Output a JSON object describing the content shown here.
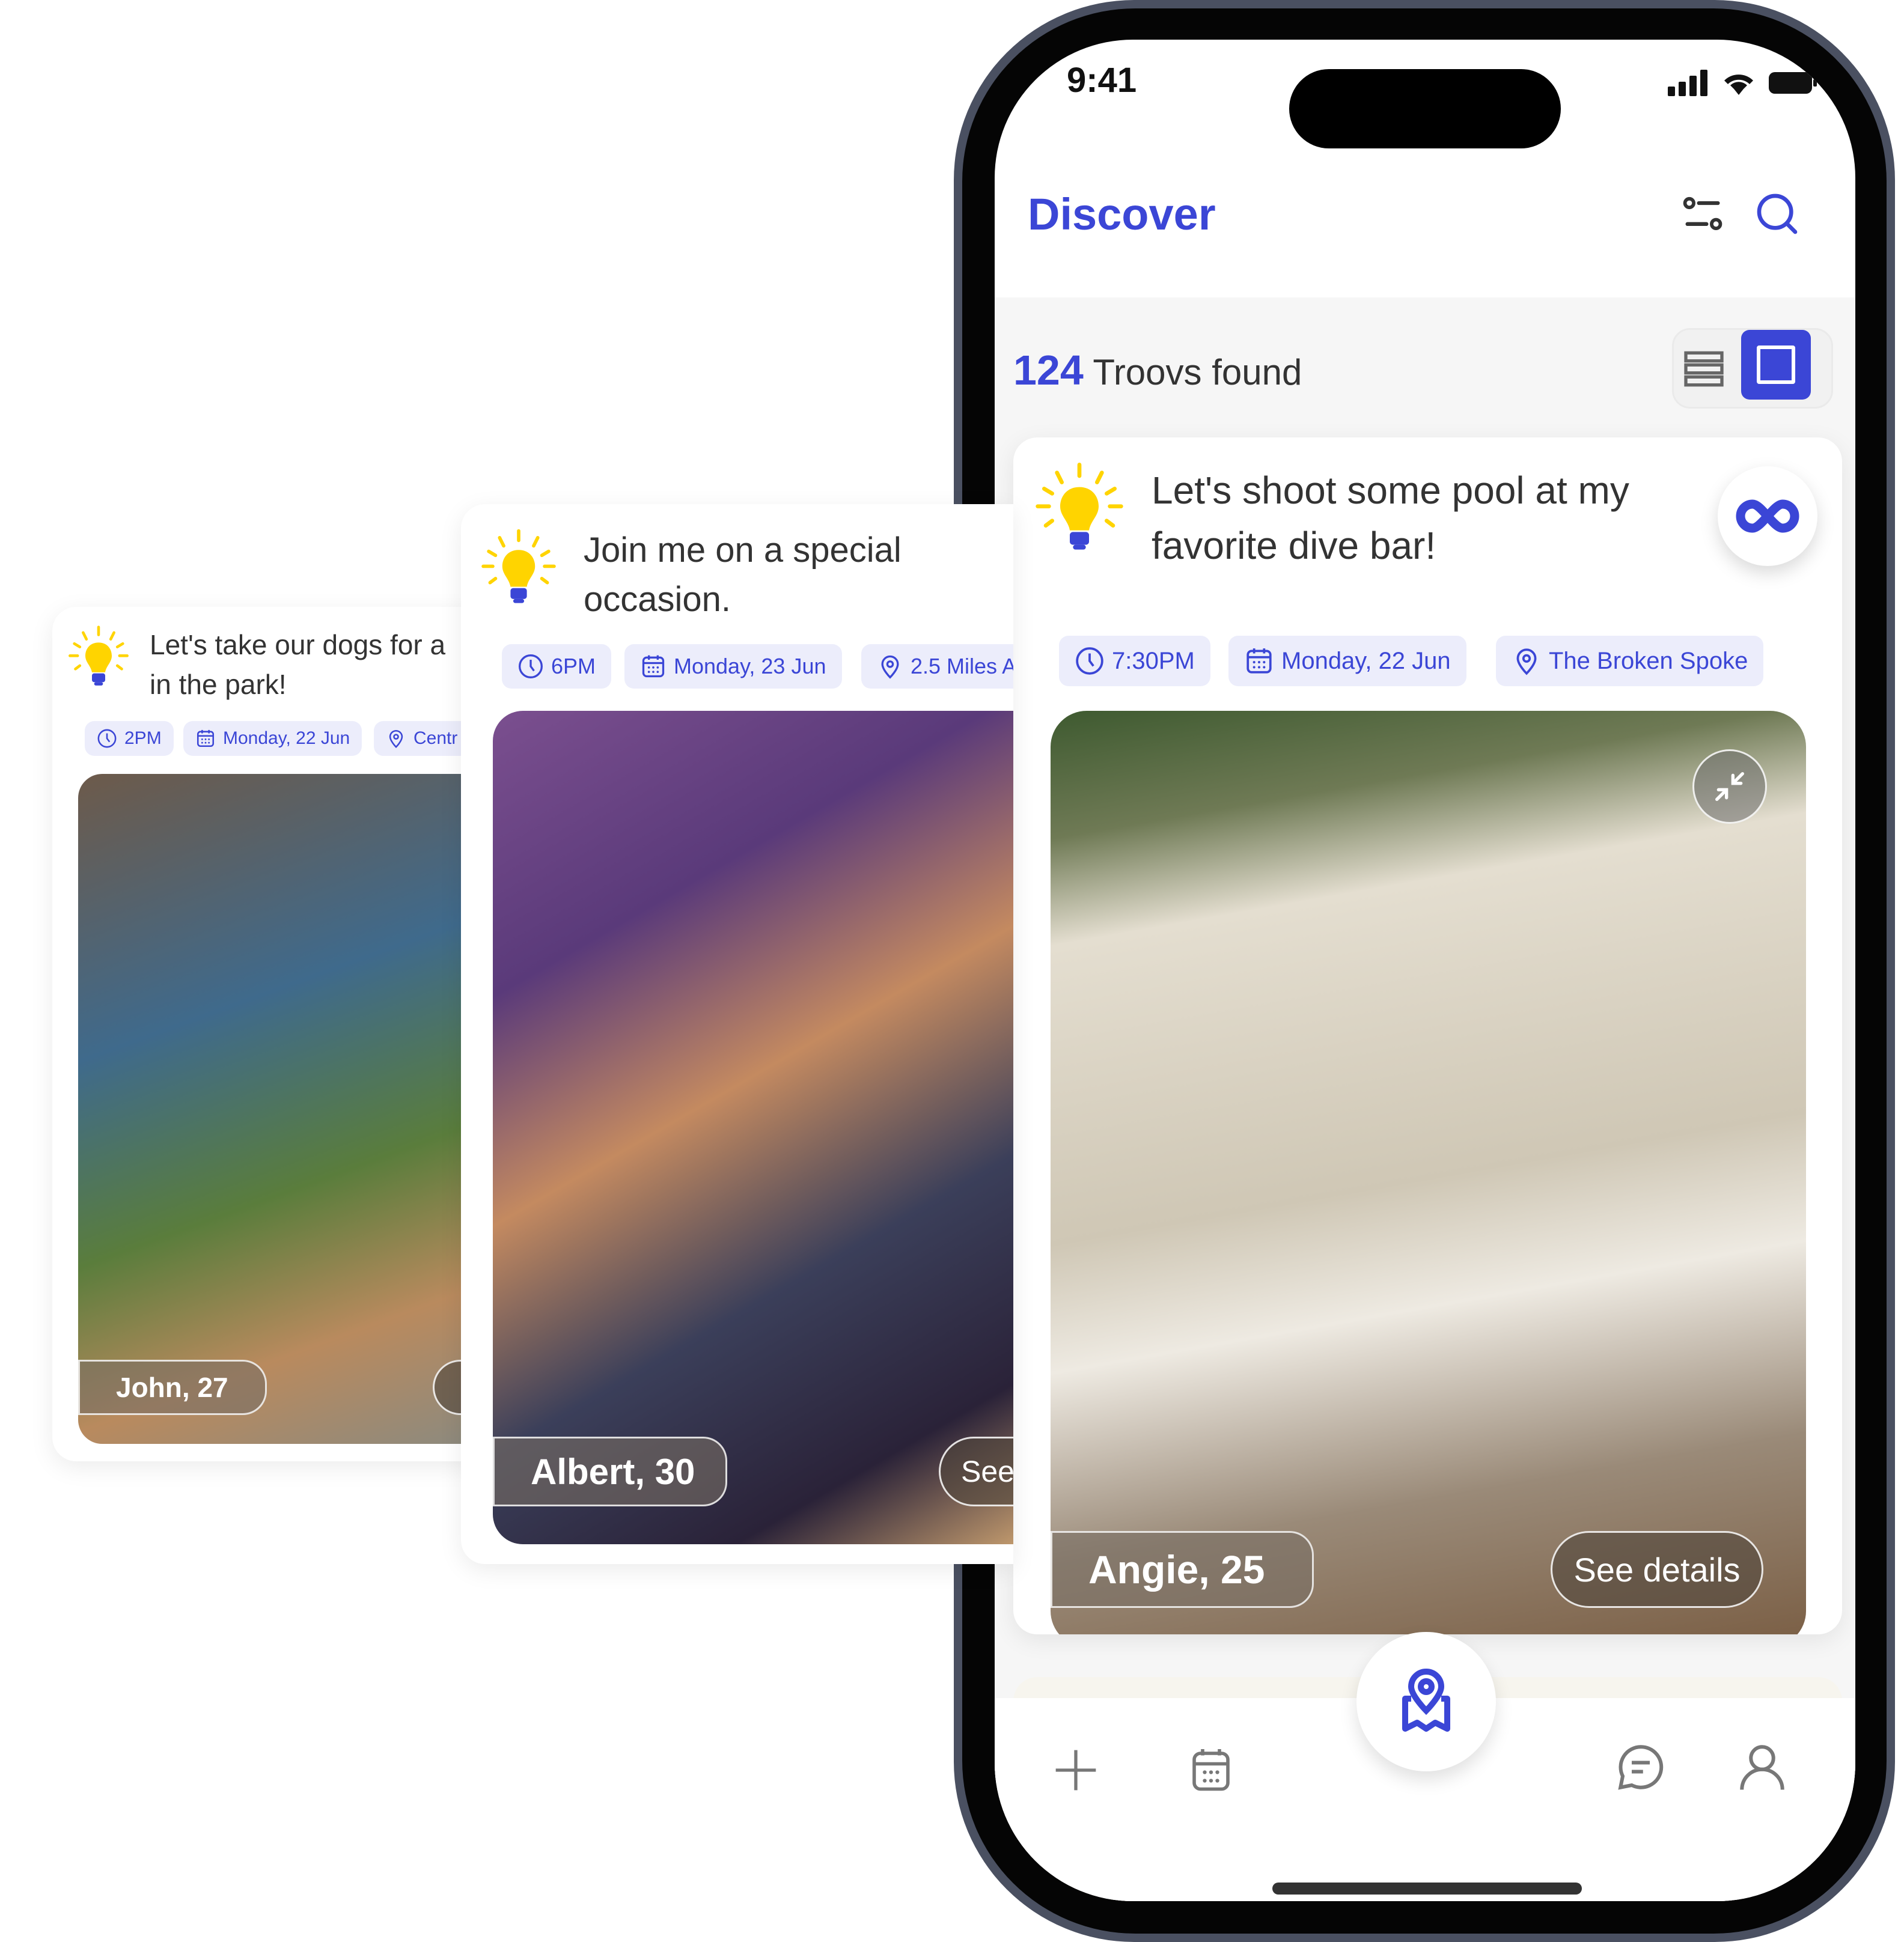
{
  "status_bar": {
    "time": "9:41"
  },
  "header": {
    "title": "Discover",
    "filter_icon": "sliders-icon",
    "search_icon": "search-icon"
  },
  "results": {
    "count": "124",
    "label": "Troovs found",
    "view_list_icon": "list-view-icon",
    "view_card_icon": "card-view-icon",
    "active_view": "card"
  },
  "colors": {
    "accent": "#3b46d6",
    "chip_bg": "#ecedfb",
    "bulb": "#ffd400"
  },
  "cards": [
    {
      "title": "Let's take our dogs for a walk in the park!",
      "title_line1": "Let's take our dogs for a",
      "title_line2": "in the park!",
      "time": "2PM",
      "date": "Monday, 22 Jun",
      "location": "Centr",
      "name": "John, 27",
      "details": "S"
    },
    {
      "title_line1": "Join me on a special",
      "title_line2": "occasion.",
      "time": "6PM",
      "date": "Monday, 23 Jun",
      "location": "2.5 Miles A",
      "name": "Albert, 30",
      "details": "See"
    },
    {
      "title_line1": "Let's shoot some pool at my",
      "title_line2": "favorite dive bar!",
      "time": "7:30PM",
      "date": "Monday, 22 Jun",
      "location": "The Broken Spoke",
      "name": "Angie, 25",
      "details": "See details"
    }
  ],
  "nav": {
    "items": [
      "add-icon",
      "calendar-icon",
      "discover-map-icon",
      "chat-icon",
      "profile-icon"
    ],
    "active": "discover-map-icon"
  }
}
